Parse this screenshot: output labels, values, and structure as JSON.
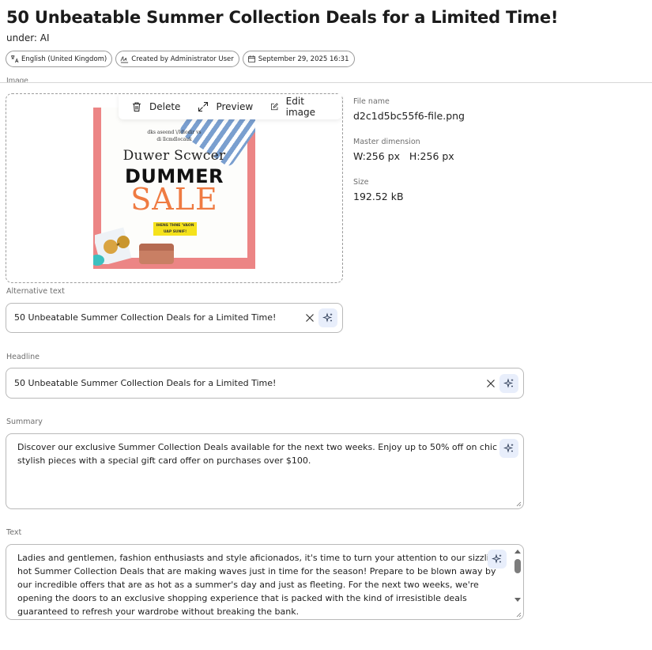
{
  "page": {
    "title": "50 Unbeatable Summer Collection Deals for a Limited Time!",
    "subtitle": "under: AI"
  },
  "chips": {
    "language": "English (United Kingdom)",
    "created_by": "Created by Administrator User",
    "date": "September 29, 2025 16:31"
  },
  "image_section": {
    "label": "Image",
    "toolbar": {
      "delete": "Delete",
      "preview": "Preview",
      "edit": "Edit image"
    },
    "promo": {
      "small_line1": "dks aseend \\/ldiodir vs",
      "small_line2": "di llcmdlocauk",
      "script": "Duwer Scwcer",
      "headline": "DUMMER",
      "sale": "SALE",
      "tag": "IHENS THNE 'VAON UAP SUNIF!"
    }
  },
  "file_info": {
    "file_name_label": "File name",
    "file_name": "d2c1d5bc55f6-file.png",
    "dimension_label": "Master dimension",
    "dimension": "W:256 px   H:256 px",
    "size_label": "Size",
    "size": "192.52 kB"
  },
  "fields": {
    "alt_text": {
      "label": "Alternative text",
      "value": "50 Unbeatable Summer Collection Deals for a Limited Time!"
    },
    "headline": {
      "label": "Headline",
      "value": "50 Unbeatable Summer Collection Deals for a Limited Time!"
    },
    "summary": {
      "label": "Summary",
      "line1": "Discover our exclusive Summer Collection Deals available for the next two weeks. Enjoy up to 50% off on chic and",
      "line2": "stylish pieces with a special gift card offer on purchases over $100."
    },
    "text": {
      "label": "Text",
      "line1": "Ladies and gentlemen, fashion enthusiasts and style aficionados, it's time to turn your attention to our sizzling",
      "line2": "hot Summer Collection Deals that are making waves just in time for the season! Prepare to be blown away by",
      "line3": "our incredible offers that are as hot as a summer's day and just as fleeting. For the next two weeks, we're",
      "line4": "opening the doors to an exclusive shopping experience that is packed with the kind of irresistible deals",
      "line5": "guaranteed to refresh your wardrobe without breaking the bank."
    }
  },
  "colors": {
    "accent": "#e8eefb",
    "promo_border": "#ec8585",
    "sale": "#ef7b42"
  }
}
